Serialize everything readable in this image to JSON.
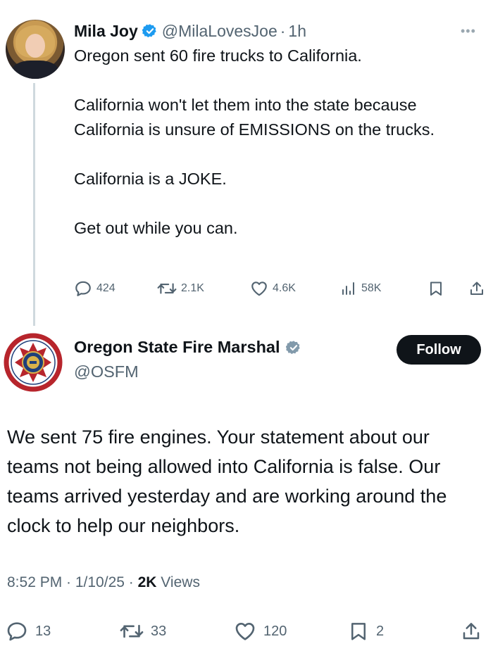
{
  "tweet1": {
    "author_name": "Mila Joy",
    "handle": "@MilaLovesJoe",
    "separator": "·",
    "time": "1h",
    "text_lines": [
      "Oregon sent 60 fire trucks to California.",
      "",
      "California won't let them into the state because California is unsure of EMISSIONS on the trucks.",
      "",
      "California is a JOKE.",
      "",
      "Get out while you can."
    ],
    "actions": {
      "replies": "424",
      "reposts": "2.1K",
      "likes": "4.6K",
      "views": "58K"
    }
  },
  "tweet2": {
    "author_name": "Oregon State Fire Marshal",
    "handle": "@OSFM",
    "follow_label": "Follow",
    "text": "We sent 75 fire engines. Your statement about our teams not being allowed into California is false. Our teams arrived yesterday and are working around the clock to help our neighbors.",
    "timestamp": "8:52 PM · 1/10/25 · ",
    "views_count": "2K",
    "views_label": " Views",
    "actions": {
      "replies": "13",
      "reposts": "33",
      "likes": "120",
      "bookmarks": "2"
    }
  },
  "colors": {
    "text": "#0f1419",
    "secondary": "#536471",
    "verified_blue": "#1d9bf0",
    "verified_gray": "#829aab",
    "follow_bg": "#0f1419"
  },
  "icons": [
    "more-icon",
    "verified-badge-icon",
    "reply-icon",
    "repost-icon",
    "like-icon",
    "views-icon",
    "bookmark-icon",
    "share-icon"
  ]
}
